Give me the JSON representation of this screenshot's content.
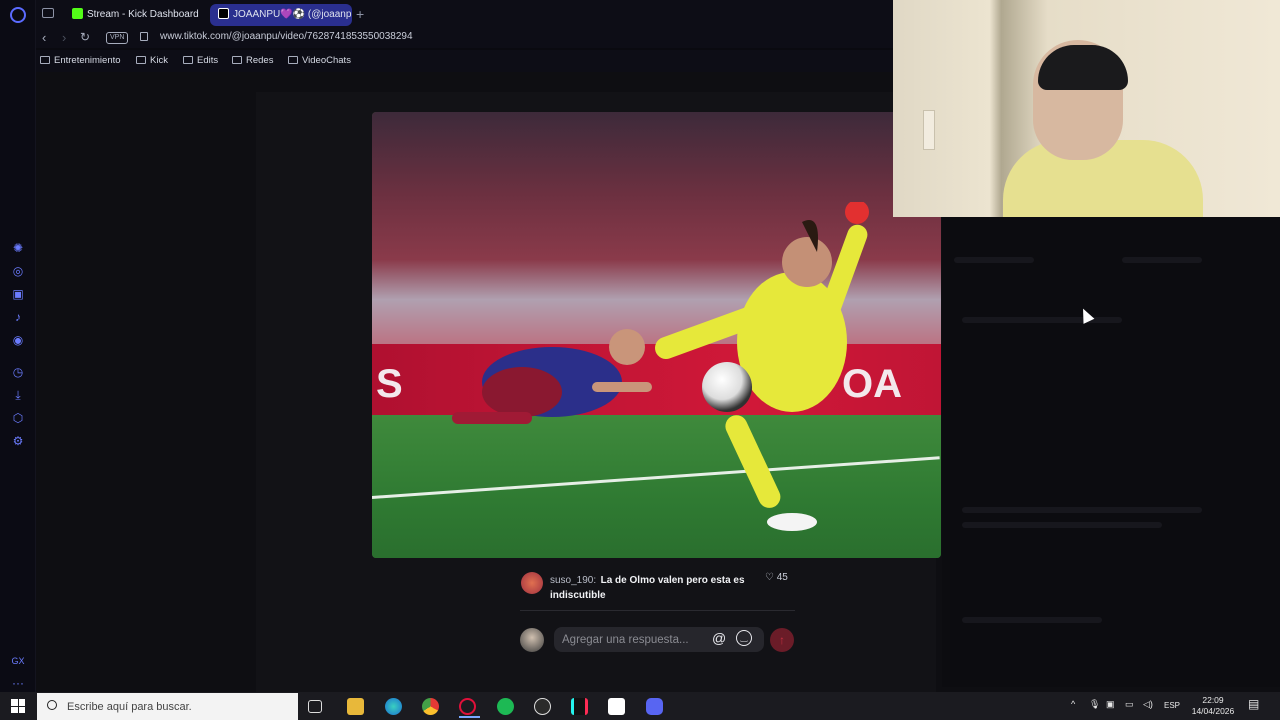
{
  "tabs": [
    {
      "label": "Stream - Kick Dashboard",
      "favicon_color": "#53fc18"
    },
    {
      "label": "JOAANPU💜⚽ (@joaanpu",
      "favicon_color": "#000000"
    }
  ],
  "address_bar": {
    "vpn_label": "VPN",
    "url": "www.tiktok.com/@joaanpu/video/7628741853550038294"
  },
  "bookmarks": [
    "Entretenimiento",
    "Kick",
    "Edits",
    "Redes",
    "VideoChats"
  ],
  "media": {
    "board_text_left": "S",
    "board_text_right": "OA"
  },
  "comment": {
    "user": "suso_190:",
    "text_line1": "La de Olmo valen pero esta es",
    "text_line2": "indiscutible",
    "likes": "45"
  },
  "reply": {
    "placeholder": "Agregar una respuesta...",
    "mention_symbol": "@"
  },
  "taskbar": {
    "search_placeholder": "Escribe aquí para buscar.",
    "language": "ESP",
    "time": "22:09",
    "date": "14/04/2026"
  },
  "colors": {
    "accent": "#5b6bff",
    "active_tab": "#2a2f8f",
    "send_button": "#6b1c28"
  }
}
